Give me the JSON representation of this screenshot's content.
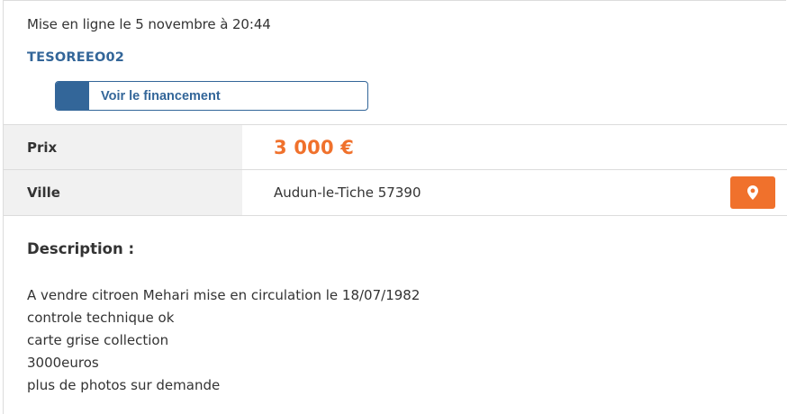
{
  "listing": {
    "date": "Mise en ligne le 5 novembre à 20:44",
    "seller": "TESOREEO02",
    "financing_button": "Voir le financement"
  },
  "details": {
    "price_label": "Prix",
    "price_value": "3 000 €",
    "city_label": "Ville",
    "city_value": "Audun-le-Tiche 57390",
    "map_icon": "map-marker-icon"
  },
  "description": {
    "title": "Description :",
    "lines": [
      "A vendre citroen Mehari mise en circulation le 18/07/1982",
      "controle technique ok",
      "carte grise collection",
      "3000euros",
      "plus de photos sur demande"
    ]
  },
  "colors": {
    "accent_blue": "#336699",
    "accent_orange": "#f0712c",
    "label_bg": "#f1f1f1"
  }
}
